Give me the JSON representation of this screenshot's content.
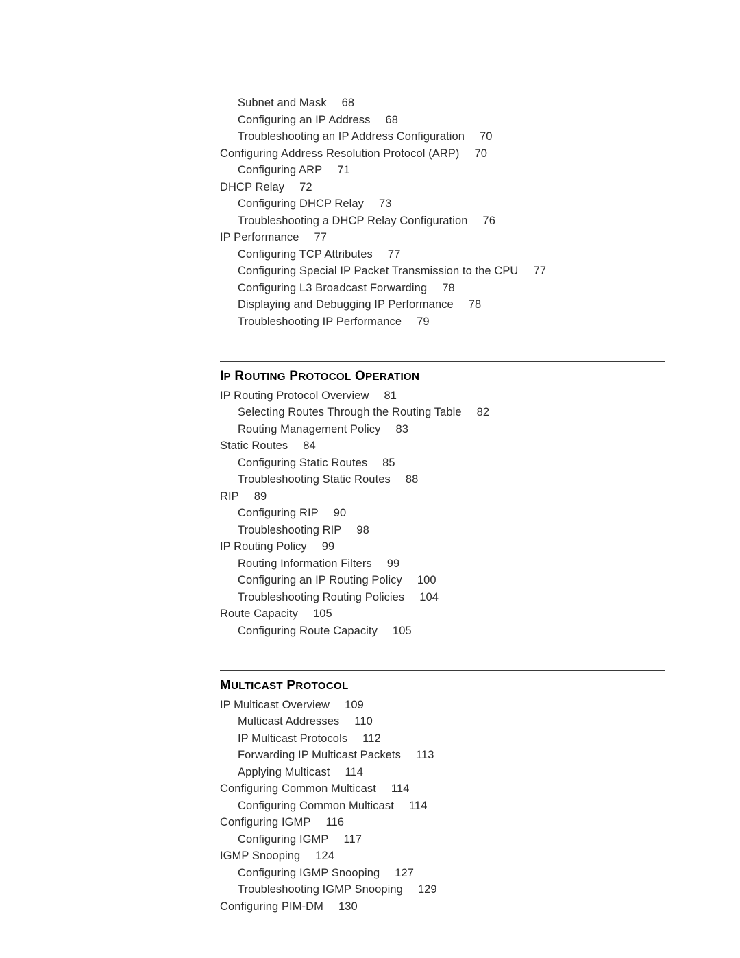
{
  "document": {
    "type": "table-of-contents",
    "background_color": "#ffffff",
    "text_color": "#2b2b2b",
    "heading_color": "#000000",
    "rule_color": "#3a3a3a"
  },
  "blocks": [
    {
      "kind": "entries",
      "entries": [
        {
          "level": 2,
          "title": "Subnet and Mask",
          "page": "68"
        },
        {
          "level": 2,
          "title": "Configuring an IP Address",
          "page": "68"
        },
        {
          "level": 2,
          "title": "Troubleshooting an IP Address Configuration",
          "page": "70"
        },
        {
          "level": 1,
          "title": "Configuring Address Resolution Protocol (ARP)",
          "page": "70"
        },
        {
          "level": 2,
          "title": "Configuring ARP",
          "page": "71"
        },
        {
          "level": 1,
          "title": "DHCP Relay",
          "page": "72"
        },
        {
          "level": 2,
          "title": "Configuring DHCP Relay",
          "page": "73"
        },
        {
          "level": 2,
          "title": "Troubleshooting a DHCP Relay Configuration",
          "page": "76"
        },
        {
          "level": 1,
          "title": "IP Performance",
          "page": "77"
        },
        {
          "level": 2,
          "title": "Configuring TCP Attributes",
          "page": "77"
        },
        {
          "level": 2,
          "title": "Configuring Special IP Packet Transmission to the CPU",
          "page": "77"
        },
        {
          "level": 2,
          "title": "Configuring L3 Broadcast Forwarding",
          "page": "78"
        },
        {
          "level": 2,
          "title": "Displaying and Debugging IP Performance",
          "page": "78"
        },
        {
          "level": 2,
          "title": "Troubleshooting IP Performance",
          "page": "79"
        }
      ]
    },
    {
      "kind": "section",
      "heading": "IP ROUTING PROTOCOL OPERATION",
      "heading_words": [
        "IP",
        "ROUTING",
        "PROTOCOL",
        "OPERATION"
      ],
      "entries": [
        {
          "level": 1,
          "title": "IP Routing Protocol Overview",
          "page": "81"
        },
        {
          "level": 2,
          "title": "Selecting Routes Through the Routing Table",
          "page": "82"
        },
        {
          "level": 2,
          "title": "Routing Management Policy",
          "page": "83"
        },
        {
          "level": 1,
          "title": "Static Routes",
          "page": "84"
        },
        {
          "level": 2,
          "title": "Configuring Static Routes",
          "page": "85"
        },
        {
          "level": 2,
          "title": "Troubleshooting Static Routes",
          "page": "88"
        },
        {
          "level": 1,
          "title": "RIP",
          "page": "89"
        },
        {
          "level": 2,
          "title": "Configuring RIP",
          "page": "90"
        },
        {
          "level": 2,
          "title": "Troubleshooting RIP",
          "page": "98"
        },
        {
          "level": 1,
          "title": "IP Routing Policy",
          "page": "99"
        },
        {
          "level": 2,
          "title": "Routing Information Filters",
          "page": "99"
        },
        {
          "level": 2,
          "title": "Configuring an IP Routing Policy",
          "page": "100"
        },
        {
          "level": 2,
          "title": "Troubleshooting Routing Policies",
          "page": "104"
        },
        {
          "level": 1,
          "title": "Route Capacity",
          "page": "105"
        },
        {
          "level": 2,
          "title": "Configuring Route Capacity",
          "page": "105"
        }
      ]
    },
    {
      "kind": "section",
      "heading": "MULTICAST PROTOCOL",
      "heading_words": [
        "MULTICAST",
        "PROTOCOL"
      ],
      "entries": [
        {
          "level": 1,
          "title": "IP Multicast Overview",
          "page": "109"
        },
        {
          "level": 2,
          "title": "Multicast Addresses",
          "page": "110"
        },
        {
          "level": 2,
          "title": "IP Multicast Protocols",
          "page": "112"
        },
        {
          "level": 2,
          "title": "Forwarding IP Multicast Packets",
          "page": "113"
        },
        {
          "level": 2,
          "title": "Applying Multicast",
          "page": "114"
        },
        {
          "level": 1,
          "title": "Configuring Common Multicast",
          "page": "114"
        },
        {
          "level": 2,
          "title": "Configuring Common Multicast",
          "page": "114"
        },
        {
          "level": 1,
          "title": "Configuring IGMP",
          "page": "116"
        },
        {
          "level": 2,
          "title": "Configuring IGMP",
          "page": "117"
        },
        {
          "level": 1,
          "title": "IGMP Snooping",
          "page": "124"
        },
        {
          "level": 2,
          "title": "Configuring IGMP Snooping",
          "page": "127"
        },
        {
          "level": 2,
          "title": "Troubleshooting IGMP Snooping",
          "page": "129"
        },
        {
          "level": 1,
          "title": "Configuring PIM-DM",
          "page": "130"
        }
      ]
    }
  ]
}
